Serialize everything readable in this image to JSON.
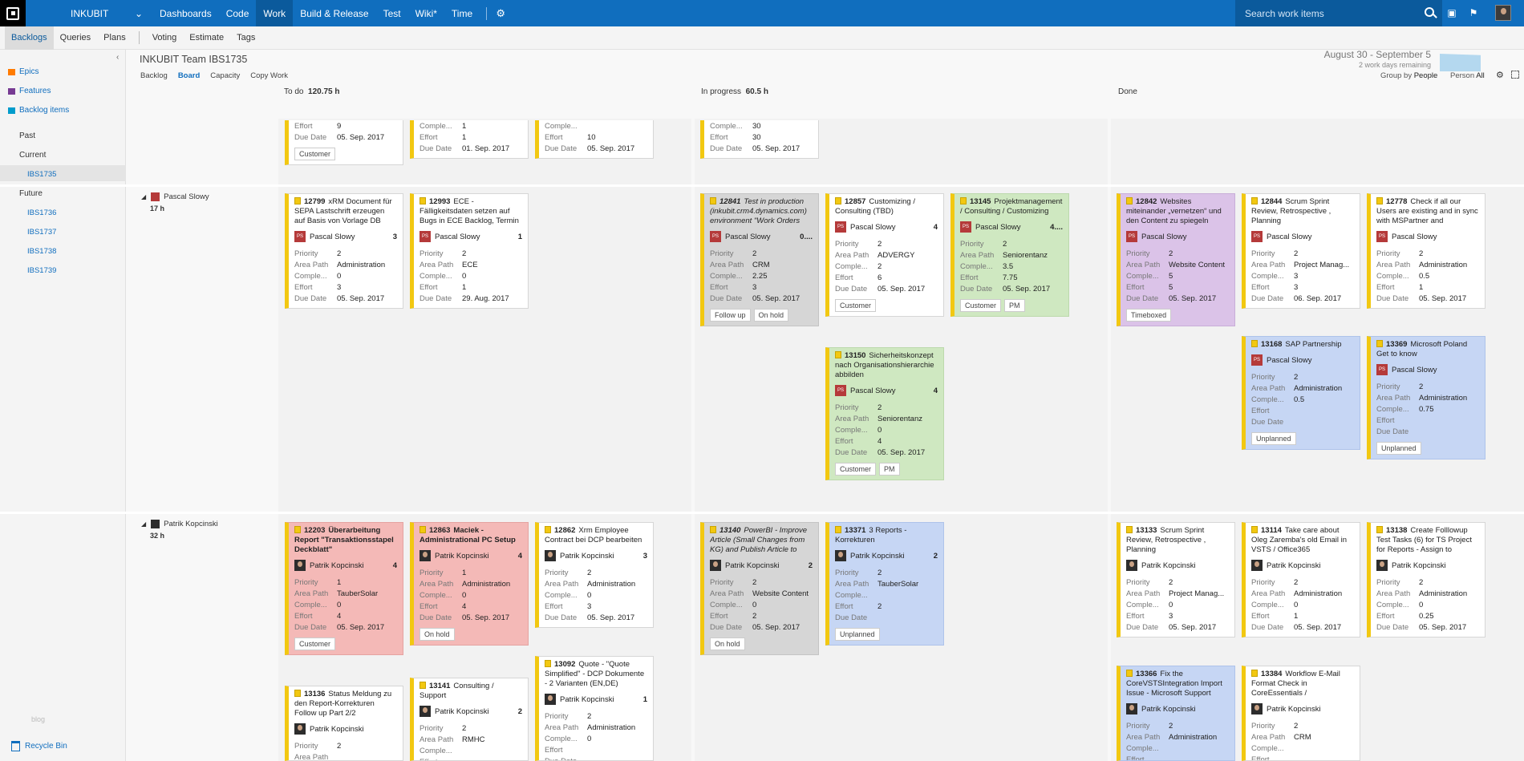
{
  "topnav": {
    "project": "INKUBIT",
    "items": [
      "Dashboards",
      "Code",
      "Work",
      "Build & Release",
      "Test",
      "Wiki*",
      "Time"
    ],
    "active": "Work",
    "search_placeholder": "Search work items"
  },
  "subnav": {
    "items": [
      "Backlogs",
      "Queries",
      "Plans",
      "Voting",
      "Estimate",
      "Tags"
    ],
    "active": "Backlogs"
  },
  "sidebar": {
    "backlogs": [
      "Epics",
      "Features",
      "Backlog items"
    ],
    "past": "Past",
    "current": "Current",
    "current_iteration": "IBS1735",
    "future": "Future",
    "future_iterations": [
      "IBS1736",
      "IBS1737",
      "IBS1738",
      "IBS1739"
    ],
    "blog": "blog",
    "recycle": "Recycle Bin"
  },
  "header": {
    "team": "INKUBIT Team IBS1735",
    "pivots": [
      "Backlog",
      "Board",
      "Capacity",
      "Copy Work"
    ],
    "sprint_dates": "August 30 - September 5",
    "sprint_remaining": "2 work days remaining",
    "group_by_label": "Group by",
    "group_by_value": "People",
    "person_label": "Person",
    "person_value": "All"
  },
  "columns": [
    {
      "name": "To do",
      "hours": "120.75 h"
    },
    {
      "name": "In progress",
      "hours": "60.5 h"
    },
    {
      "name": "Done",
      "hours": ""
    }
  ],
  "lanes": [
    {
      "name": "Pascal Slowy",
      "hours": "17 h"
    },
    {
      "name": "Patrik Kopcinski",
      "hours": "32 h"
    }
  ],
  "field_labels": {
    "priority": "Priority",
    "area": "Area Path",
    "comple": "Comple...",
    "effort": "Effort",
    "due": "Due Date"
  },
  "cards_top": [
    {
      "rows": [
        [
          "Effort",
          "9"
        ],
        [
          "Due Date",
          "05. Sep. 2017"
        ]
      ],
      "tags": [
        "Customer"
      ]
    },
    {
      "rows": [
        [
          "Comple...",
          "1"
        ],
        [
          "Effort",
          "1"
        ],
        [
          "Due Date",
          "01. Sep. 2017"
        ]
      ],
      "tags": []
    },
    {
      "rows": [
        [
          "Comple...",
          ""
        ],
        [
          "Effort",
          "10"
        ],
        [
          "Due Date",
          "05. Sep. 2017"
        ]
      ],
      "tags": []
    },
    {
      "rows": [
        [
          "Comple...",
          "30"
        ],
        [
          "Effort",
          "30"
        ],
        [
          "Due Date",
          "05. Sep. 2017"
        ]
      ],
      "tags": []
    }
  ],
  "cards": [
    {
      "id": "12799",
      "title": "xRM Document für SEPA Lastschrift erzeugen auf Basis von Vorlage DB",
      "assignee": "Pascal Slowy",
      "av": "PS",
      "rem": "3",
      "priority": "2",
      "area": "Administration",
      "comple": "0",
      "effort": "3",
      "due": "05. Sep. 2017",
      "tags": []
    },
    {
      "id": "12993",
      "title": "ECE - Fälligkeitsdaten setzen auf Bugs in ECE Backlog, Termin",
      "assignee": "Pascal Slowy",
      "av": "PS",
      "rem": "1",
      "priority": "2",
      "area": "ECE",
      "comple": "0",
      "effort": "1",
      "due": "29. Aug. 2017",
      "tags": []
    },
    {
      "id": "12841",
      "title": "Test in production (inkubit.crm4.dynamics.com) environment \"Work Orders",
      "assignee": "Pascal Slowy",
      "av": "PS",
      "rem": "0....",
      "priority": "2",
      "area": "CRM",
      "comple": "2.25",
      "effort": "3",
      "due": "05. Sep. 2017",
      "tags": [
        "Follow up",
        "On hold"
      ]
    },
    {
      "id": "12857",
      "title": "Customizing / Consulting (TBD)",
      "assignee": "Pascal Slowy",
      "av": "PS",
      "rem": "4",
      "priority": "2",
      "area": "ADVERGY",
      "comple": "2",
      "effort": "6",
      "due": "05. Sep. 2017",
      "tags": [
        "Customer"
      ]
    },
    {
      "id": "13145",
      "title": "Projektmanagement / Consulting / Customizing",
      "assignee": "Pascal Slowy",
      "av": "PS",
      "rem": "4....",
      "priority": "2",
      "area": "Seniorentanz",
      "comple": "3.5",
      "effort": "7.75",
      "due": "05. Sep. 2017",
      "tags": [
        "Customer",
        "PM"
      ]
    },
    {
      "id": "13150",
      "title": "Sicherheitskonzept nach Organisationshierarchie abbilden",
      "assignee": "Pascal Slowy",
      "av": "PS",
      "rem": "4",
      "priority": "2",
      "area": "Seniorentanz",
      "comple": "0",
      "effort": "4",
      "due": "05. Sep. 2017",
      "tags": [
        "Customer",
        "PM"
      ]
    },
    {
      "id": "12842",
      "title": "Websites miteinander „vernetzen“ und den Content zu spiegeln",
      "assignee": "Pascal Slowy",
      "av": "PS",
      "rem": "",
      "priority": "2",
      "area": "Website Content",
      "comple": "5",
      "effort": "5",
      "due": "05. Sep. 2017",
      "tags": [
        "Timeboxed"
      ]
    },
    {
      "id": "12844",
      "title": "Scrum Sprint Review, Retrospective , Planning",
      "assignee": "Pascal Slowy",
      "av": "PS",
      "rem": "",
      "priority": "2",
      "area": "Project Manag...",
      "comple": "3",
      "effort": "3",
      "due": "06. Sep. 2017",
      "tags": []
    },
    {
      "id": "12778",
      "title": "Check if all our Users are existing and in sync with MSPartner and",
      "assignee": "Pascal Slowy",
      "av": "PS",
      "rem": "",
      "priority": "2",
      "area": "Administration",
      "comple": "0.5",
      "effort": "1",
      "due": "05. Sep. 2017",
      "tags": []
    },
    {
      "id": "13168",
      "title": "SAP Partnership",
      "assignee": "Pascal Slowy",
      "av": "PS",
      "rem": "",
      "priority": "2",
      "area": "Administration",
      "comple": "0.5",
      "effort": "",
      "due": "",
      "tags": [
        "Unplanned"
      ]
    },
    {
      "id": "13369",
      "title": "Microsoft Poland Get to know",
      "assignee": "Pascal Slowy",
      "av": "PS",
      "rem": "",
      "priority": "2",
      "area": "Administration",
      "comple": "0.75",
      "effort": "",
      "due": "",
      "tags": [
        "Unplanned"
      ]
    },
    {
      "id": "12203",
      "title": "Überarbeitung Report \"Transaktionsstapel Deckblatt\"",
      "assignee": "Patrik Kopcinski",
      "av": "PK",
      "rem": "4",
      "priority": "1",
      "area": "TauberSolar",
      "comple": "0",
      "effort": "4",
      "due": "05. Sep. 2017",
      "tags": [
        "Customer"
      ]
    },
    {
      "id": "12863",
      "title": "Maciek - Administrational PC Setup",
      "assignee": "Patrik Kopcinski",
      "av": "PK",
      "rem": "4",
      "priority": "1",
      "area": "Administration",
      "comple": "0",
      "effort": "4",
      "due": "05. Sep. 2017",
      "tags": [
        "On hold"
      ]
    },
    {
      "id": "12862",
      "title": "Xrm Employee Contract bei DCP bearbeiten",
      "assignee": "Patrik Kopcinski",
      "av": "PK",
      "rem": "3",
      "priority": "2",
      "area": "Administration",
      "comple": "0",
      "effort": "3",
      "due": "05. Sep. 2017",
      "tags": []
    },
    {
      "id": "13092",
      "title": "Quote - \"Quote Simplified\" - DCP Dokumente - 2 Varianten (EN,DE)",
      "assignee": "Patrik Kopcinski",
      "av": "PK",
      "rem": "1",
      "priority": "2",
      "area": "Administration",
      "comple": "0",
      "effort": "",
      "due": "",
      "tags": []
    },
    {
      "id": "13136",
      "title": "Status Meldung zu den Report-Korrekturen Follow up Part 2/2",
      "assignee": "Patrik Kopcinski",
      "av": "PK",
      "rem": "",
      "priority": "2",
      "area": "",
      "comple": "",
      "effort": "",
      "due": "",
      "tags": []
    },
    {
      "id": "13141",
      "title": "Consulting / Support",
      "assignee": "Patrik Kopcinski",
      "av": "PK",
      "rem": "2",
      "priority": "2",
      "area": "RMHC",
      "comple": "",
      "effort": "",
      "due": "",
      "tags": []
    },
    {
      "id": "13140",
      "title": "PowerBI - Improve Article (Small Changes from KG) and Publish Article to",
      "assignee": "Patrik Kopcinski",
      "av": "PK",
      "rem": "2",
      "priority": "2",
      "area": "Website Content",
      "comple": "0",
      "effort": "2",
      "due": "05. Sep. 2017",
      "tags": [
        "On hold"
      ]
    },
    {
      "id": "13371",
      "title": "3 Reports - Korrekturen",
      "assignee": "Patrik Kopcinski",
      "av": "PK",
      "rem": "2",
      "priority": "2",
      "area": "TauberSolar",
      "comple": "",
      "effort": "2",
      "due": "",
      "tags": [
        "Unplanned"
      ]
    },
    {
      "id": "13133",
      "title": "Scrum Sprint Review, Retrospective , Planning",
      "assignee": "Patrik Kopcinski",
      "av": "PK",
      "rem": "",
      "priority": "2",
      "area": "Project Manag...",
      "comple": "0",
      "effort": "3",
      "due": "05. Sep. 2017",
      "tags": []
    },
    {
      "id": "13114",
      "title": "Take care about Oleg Zaremba's old Email in VSTS / Office365",
      "assignee": "Patrik Kopcinski",
      "av": "PK",
      "rem": "",
      "priority": "2",
      "area": "Administration",
      "comple": "0",
      "effort": "1",
      "due": "05. Sep. 2017",
      "tags": []
    },
    {
      "id": "13138",
      "title": "Create Folllowup Test Tasks (6) for TS Project for Reports - Assign to",
      "assignee": "Patrik Kopcinski",
      "av": "PK",
      "rem": "",
      "priority": "2",
      "area": "Administration",
      "comple": "0",
      "effort": "0.25",
      "due": "05. Sep. 2017",
      "tags": []
    },
    {
      "id": "13366",
      "title": "Fix the CoreVSTSIntegration Import Issue - Microsoft Support",
      "assignee": "Patrik Kopcinski",
      "av": "PK",
      "rem": "",
      "priority": "2",
      "area": "Administration",
      "comple": "",
      "effort": "",
      "due": "",
      "tags": []
    },
    {
      "id": "13384",
      "title": "Workflow E-Mail Format Check in CoreEssentials /",
      "assignee": "Patrik Kopcinski",
      "av": "PK",
      "rem": "",
      "priority": "2",
      "area": "CRM",
      "comple": "",
      "effort": "",
      "due": "",
      "tags": []
    }
  ]
}
